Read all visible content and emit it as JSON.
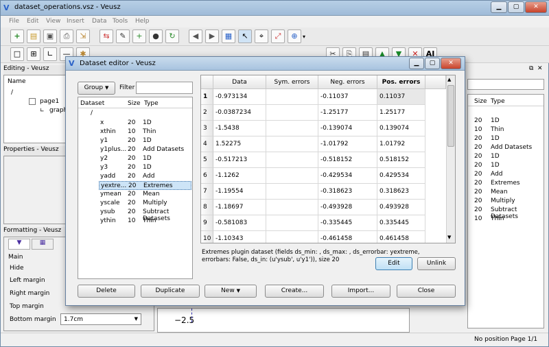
{
  "window": {
    "title": "dataset_operations.vsz - Veusz"
  },
  "menu": [
    "File",
    "Edit",
    "View",
    "Insert",
    "Data",
    "Tools",
    "Help"
  ],
  "panels": {
    "editing": "Editing - Veusz",
    "name_header": "Name",
    "tree_root": "/",
    "tree_page": "page1",
    "tree_graph": "graph",
    "properties": "Properties - Veusz",
    "formatting": "Formatting - Veusz"
  },
  "formatting": {
    "section": "Main",
    "hide": "Hide",
    "left_margin": "Left margin",
    "right_margin": "Right margin",
    "top_margin": "Top margin",
    "bottom_margin": "Bottom margin",
    "bottom_margin_value": "1.7cm"
  },
  "canvas": {
    "tick": "−2.5"
  },
  "right_panel": {
    "size_header": "Size",
    "type_header": "Type"
  },
  "status": {
    "position": "No position",
    "page": "Page 1/1"
  },
  "dialog": {
    "title": "Dataset editor - Veusz",
    "group_label": "Group",
    "filter_label": "Filter",
    "col_dataset": "Dataset",
    "col_size": "Size",
    "col_type": "Type",
    "tree_root": "/",
    "description": "Extremes plugin dataset (fields ds_min: , ds_max: , ds_errorbar: yextreme, errorbars: False, ds_in: (u'ysub', u'y1')), size 20",
    "buttons": {
      "edit": "Edit",
      "unlink": "Unlink",
      "delete": "Delete",
      "duplicate": "Duplicate",
      "new": "New",
      "create": "Create...",
      "import": "Import...",
      "close": "Close"
    }
  },
  "datasets": [
    {
      "name": "x",
      "size": "20",
      "type": "1D"
    },
    {
      "name": "xthin",
      "size": "10",
      "type": "Thin"
    },
    {
      "name": "y1",
      "size": "20",
      "type": "1D"
    },
    {
      "name": "y1plus...",
      "size": "20",
      "type": "Add Datasets"
    },
    {
      "name": "y2",
      "size": "20",
      "type": "1D"
    },
    {
      "name": "y3",
      "size": "20",
      "type": "1D"
    },
    {
      "name": "yadd",
      "size": "20",
      "type": "Add"
    },
    {
      "name": "yextre...",
      "size": "20",
      "type": "Extremes"
    },
    {
      "name": "ymean",
      "size": "20",
      "type": "Mean"
    },
    {
      "name": "yscale",
      "size": "20",
      "type": "Multiply"
    },
    {
      "name": "ysub",
      "size": "20",
      "type": "Subtract Datasets"
    },
    {
      "name": "ythin",
      "size": "10",
      "type": "Thin"
    },
    {
      "name": "",
      "size": "",
      "type": ""
    }
  ],
  "grid": {
    "headers": [
      "Data",
      "Sym. errors",
      "Neg. errors",
      "Pos. errors"
    ],
    "rows": [
      {
        "n": "1",
        "data": "-0.973134",
        "sym": "",
        "neg": "-0.11037",
        "pos": "0.11037"
      },
      {
        "n": "2",
        "data": "-0.0387234",
        "sym": "",
        "neg": "-1.25177",
        "pos": "1.25177"
      },
      {
        "n": "3",
        "data": "-1.5438",
        "sym": "",
        "neg": "-0.139074",
        "pos": "0.139074"
      },
      {
        "n": "4",
        "data": "1.52275",
        "sym": "",
        "neg": "-1.01792",
        "pos": "1.01792"
      },
      {
        "n": "5",
        "data": "-0.517213",
        "sym": "",
        "neg": "-0.518152",
        "pos": "0.518152"
      },
      {
        "n": "6",
        "data": "-1.1262",
        "sym": "",
        "neg": "-0.429534",
        "pos": "0.429534"
      },
      {
        "n": "7",
        "data": "-1.19554",
        "sym": "",
        "neg": "-0.318623",
        "pos": "0.318623"
      },
      {
        "n": "8",
        "data": "-1.18697",
        "sym": "",
        "neg": "-0.493928",
        "pos": "0.493928"
      },
      {
        "n": "9",
        "data": "-0.581083",
        "sym": "",
        "neg": "-0.335445",
        "pos": "0.335445"
      },
      {
        "n": "10",
        "data": "-1.10343",
        "sym": "",
        "neg": "-0.461458",
        "pos": "0.461458"
      }
    ]
  },
  "colors": {
    "accent": "#3c7fb1",
    "titlebar": "#a8c3df",
    "selection": "#cde4f7"
  }
}
